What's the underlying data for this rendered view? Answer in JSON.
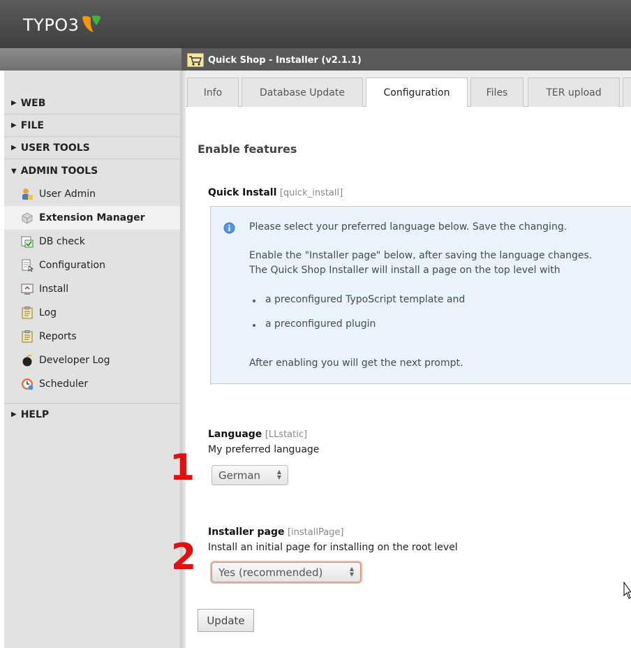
{
  "app": {
    "logo_text": "TYPO3",
    "accent": "#f49700"
  },
  "module": {
    "title": "Quick Shop - Installer (v2.1.1)"
  },
  "sidebar": {
    "sections": [
      {
        "label": "WEB",
        "expanded": false
      },
      {
        "label": "FILE",
        "expanded": false
      },
      {
        "label": "USER TOOLS",
        "expanded": false
      },
      {
        "label": "ADMIN TOOLS",
        "expanded": true
      },
      {
        "label": "HELP",
        "expanded": false
      }
    ],
    "items": [
      {
        "label": "User Admin",
        "icon": "user-admin-icon"
      },
      {
        "label": "Extension Manager",
        "icon": "extension-manager-icon",
        "active": true
      },
      {
        "label": "DB check",
        "icon": "db-check-icon"
      },
      {
        "label": "Configuration",
        "icon": "configuration-icon"
      },
      {
        "label": "Install",
        "icon": "install-icon"
      },
      {
        "label": "Log",
        "icon": "log-icon"
      },
      {
        "label": "Reports",
        "icon": "reports-icon"
      },
      {
        "label": "Developer Log",
        "icon": "developer-log-icon"
      },
      {
        "label": "Scheduler",
        "icon": "scheduler-icon"
      }
    ]
  },
  "tabs": [
    {
      "label": "Info"
    },
    {
      "label": "Database Update"
    },
    {
      "label": "Configuration",
      "active": true
    },
    {
      "label": "Files"
    },
    {
      "label": "TER upload"
    }
  ],
  "main": {
    "heading": "Enable features",
    "quick_install": {
      "label": "Quick Install",
      "key": "[quick_install]",
      "info": {
        "line1": "Please select your preferred language below. Save the changing.",
        "line2": "Enable the \"Installer page\" below, after saving the language changes.",
        "line3": "The Quick Shop Installer will install a page on the top level with",
        "bullet1": "a preconfigured TypoScript template and",
        "bullet2": "a preconfigured plugin",
        "line4": "After enabling you will get the next prompt."
      }
    },
    "language": {
      "label": "Language",
      "key": "[LLstatic]",
      "description": "My preferred language",
      "value": "German",
      "marker": "1"
    },
    "installer_page": {
      "label": "Installer page",
      "key": "[installPage]",
      "description": "Install an initial page for installing on the root level",
      "value": "Yes (recommended)",
      "marker": "2"
    },
    "update_button": "Update"
  }
}
